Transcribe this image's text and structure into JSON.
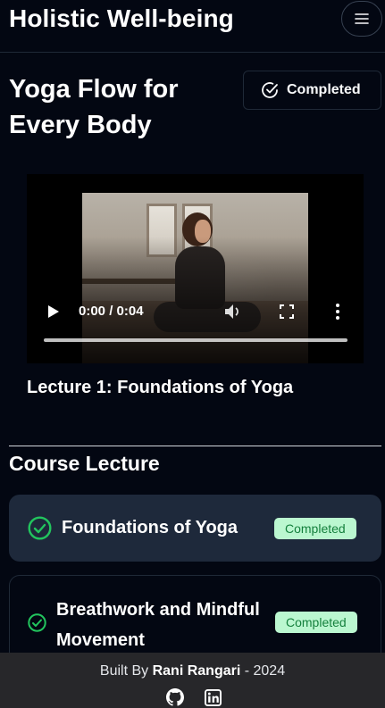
{
  "header": {
    "brand": "Holistic Well-being",
    "menu_icon": "hamburger-icon"
  },
  "course": {
    "title": "Yoga Flow for Every Body",
    "status_label": "Completed"
  },
  "video": {
    "time": "0:00 / 0:04",
    "progress": 0
  },
  "current_lecture": {
    "caption": "Lecture 1: Foundations of Yoga"
  },
  "section": {
    "title": "Course Lecture"
  },
  "lectures": [
    {
      "title": "Foundations of Yoga",
      "status": "Completed"
    },
    {
      "title": "Breathwork and Mindful Movement",
      "status": "Completed"
    }
  ],
  "footer": {
    "prefix": "Built By ",
    "author": "Rani Rangari",
    "suffix": " - 2024"
  },
  "colors": {
    "background": "#030712",
    "success": "#22c55e",
    "badge_bg": "#bbf7d0",
    "badge_text": "#15803d",
    "footer_bg": "#27272a"
  }
}
